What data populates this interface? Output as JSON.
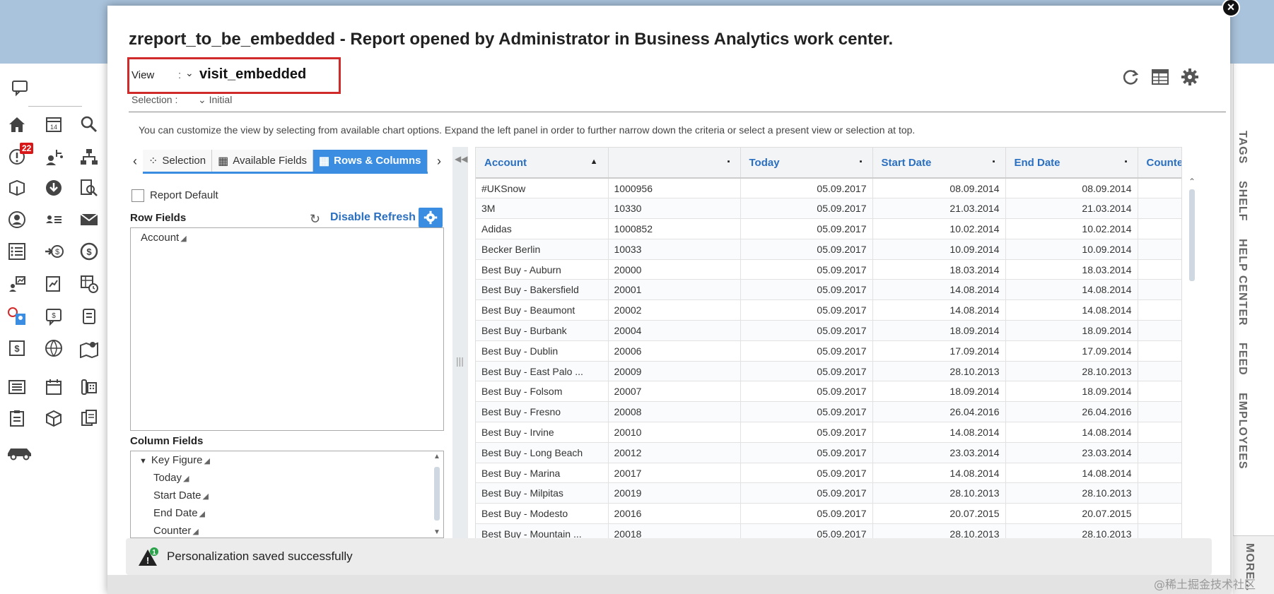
{
  "modal": {
    "title": "zreport_to_be_embedded - Report opened by Administrator in Business Analytics work center.",
    "close_label": "×"
  },
  "view": {
    "label": "View",
    "colon": ":",
    "value": "visit_embedded"
  },
  "selection": {
    "label": "Selection :",
    "value": "Initial"
  },
  "hint": "You can customize the view by selecting from available chart options. Expand the left panel in order to further narrow down the criteria or select a present view or selection at top.",
  "tabs": [
    {
      "label": "Selection",
      "active": false
    },
    {
      "label": "Available Fields",
      "active": false
    },
    {
      "label": "Rows & Columns",
      "active": true
    }
  ],
  "report_default": {
    "label": "Report Default",
    "checked": false
  },
  "row_fields": {
    "title": "Row Fields",
    "disable_refresh": "Disable Refresh",
    "items": [
      "Account"
    ]
  },
  "column_fields": {
    "title": "Column Fields",
    "group": "Key Figure",
    "items": [
      "Today",
      "Start Date",
      "End Date",
      "Counter"
    ]
  },
  "table": {
    "columns": [
      "Account",
      "",
      "Today",
      "Start Date",
      "End Date",
      "Counte"
    ],
    "rows": [
      [
        "#UKSnow",
        "1000956",
        "05.09.2017",
        "08.09.2014",
        "08.09.2014"
      ],
      [
        "3M",
        "10330",
        "05.09.2017",
        "21.03.2014",
        "21.03.2014"
      ],
      [
        "Adidas",
        "1000852",
        "05.09.2017",
        "10.02.2014",
        "10.02.2014"
      ],
      [
        "Becker Berlin",
        "10033",
        "05.09.2017",
        "10.09.2014",
        "10.09.2014"
      ],
      [
        "Best Buy - Auburn",
        "20000",
        "05.09.2017",
        "18.03.2014",
        "18.03.2014"
      ],
      [
        "Best Buy - Bakersfield",
        "20001",
        "05.09.2017",
        "14.08.2014",
        "14.08.2014"
      ],
      [
        "Best Buy - Beaumont",
        "20002",
        "05.09.2017",
        "14.08.2014",
        "14.08.2014"
      ],
      [
        "Best Buy - Burbank",
        "20004",
        "05.09.2017",
        "18.09.2014",
        "18.09.2014"
      ],
      [
        "Best Buy - Dublin",
        "20006",
        "05.09.2017",
        "17.09.2014",
        "17.09.2014"
      ],
      [
        "Best Buy - East Palo ...",
        "20009",
        "05.09.2017",
        "28.10.2013",
        "28.10.2013"
      ],
      [
        "Best Buy - Folsom",
        "20007",
        "05.09.2017",
        "18.09.2014",
        "18.09.2014"
      ],
      [
        "Best Buy - Fresno",
        "20008",
        "05.09.2017",
        "26.04.2016",
        "26.04.2016"
      ],
      [
        "Best Buy - Irvine",
        "20010",
        "05.09.2017",
        "14.08.2014",
        "14.08.2014"
      ],
      [
        "Best Buy - Long Beach",
        "20012",
        "05.09.2017",
        "23.03.2014",
        "23.03.2014"
      ],
      [
        "Best Buy - Marina",
        "20017",
        "05.09.2017",
        "14.08.2014",
        "14.08.2014"
      ],
      [
        "Best Buy - Milpitas",
        "20019",
        "05.09.2017",
        "28.10.2013",
        "28.10.2013"
      ],
      [
        "Best Buy - Modesto",
        "20016",
        "05.09.2017",
        "20.07.2015",
        "20.07.2015"
      ],
      [
        "Best Buy - Mountain ...",
        "20018",
        "05.09.2017",
        "28.10.2013",
        "28.10.2013"
      ]
    ]
  },
  "toast": {
    "count": "1",
    "message": "Personalization saved successfully"
  },
  "nav": {
    "calendar_day": "14",
    "badge": "22"
  },
  "right_labels": [
    "TAGS",
    "SHELF",
    "HELP CENTER",
    "FEED",
    "EMPLOYEES"
  ],
  "more_label": "MORE...",
  "watermark": "@稀土掘金技术社区",
  "colors": {
    "accent": "#3a8de0",
    "link": "#2a6fc0",
    "highlight": "#d12a2a",
    "badge": "#d81818"
  }
}
